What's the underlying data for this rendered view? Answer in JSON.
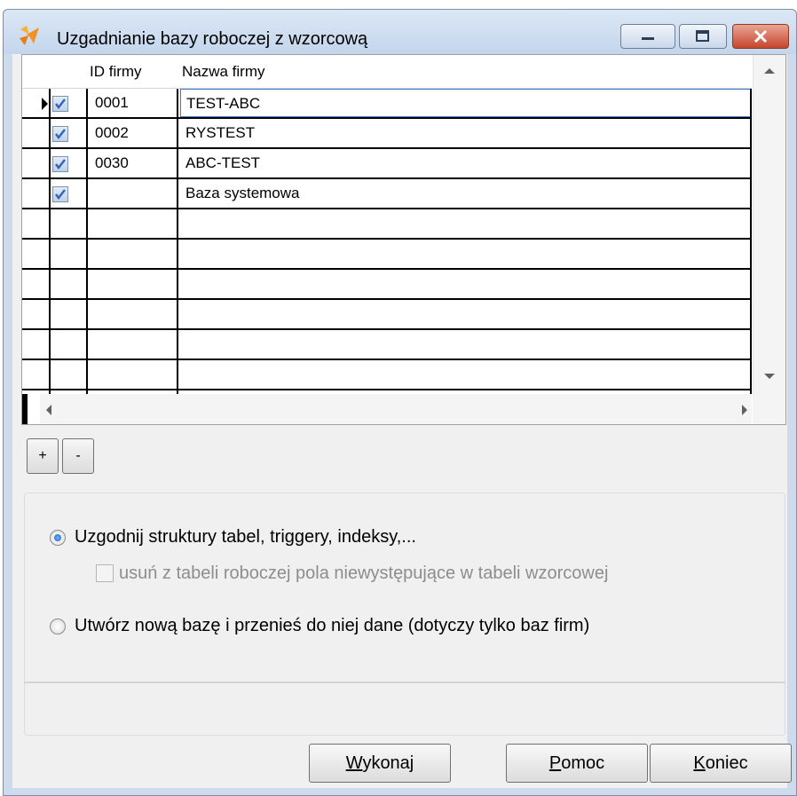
{
  "window": {
    "title": "Uzgadnianie bazy roboczej z wzorcową"
  },
  "grid": {
    "columns": [
      "ID firmy",
      "Nazwa firmy"
    ],
    "rows": [
      {
        "checked": true,
        "id": "0001",
        "name": "TEST-ABC"
      },
      {
        "checked": true,
        "id": "0002",
        "name": "RYSTEST"
      },
      {
        "checked": true,
        "id": "0030",
        "name": "ABC-TEST"
      },
      {
        "checked": true,
        "id": "",
        "name": "Baza systemowa"
      }
    ]
  },
  "grid_buttons": {
    "add": "+",
    "remove": "-"
  },
  "options": {
    "sync": {
      "label": "Uzgodnij struktury tabel, triggery, indeksy,...",
      "selected": true
    },
    "remove_fields": {
      "label": "usuń z tabeli roboczej pola niewystępujące w tabeli wzorcowej",
      "checked": false,
      "enabled": false
    },
    "new_db": {
      "label": "Utwórz nową bazę i przenieś do niej dane (dotyczy tylko baz firm)",
      "selected": false
    }
  },
  "buttons": {
    "execute": {
      "mnemonic": "W",
      "rest": "ykonaj"
    },
    "help": {
      "mnemonic": "P",
      "rest": "omoc"
    },
    "close": {
      "mnemonic": "K",
      "rest": "oniec"
    }
  }
}
